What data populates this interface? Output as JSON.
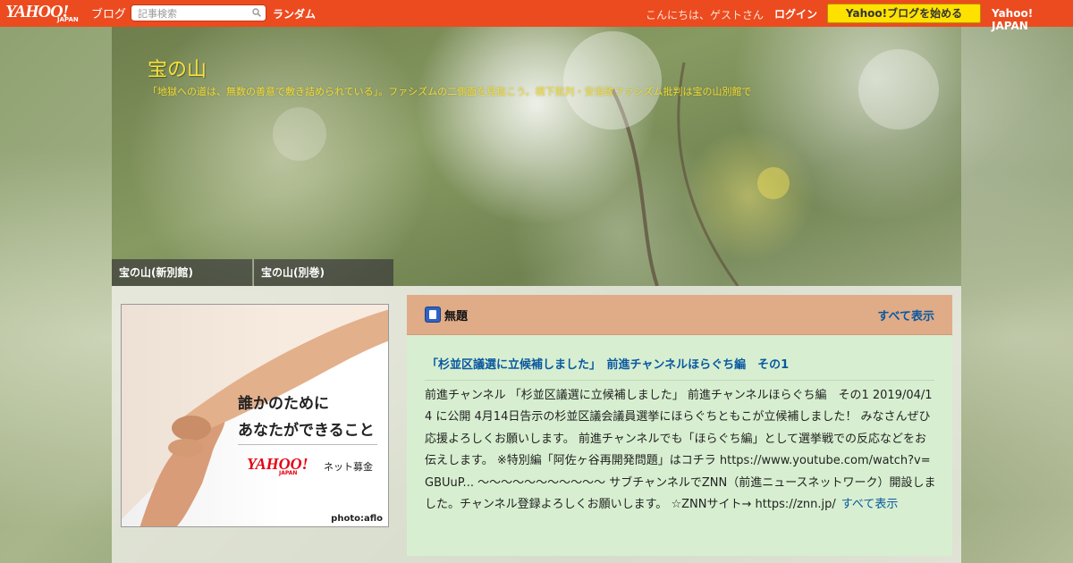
{
  "topbar": {
    "logo_text": "YAHOO!",
    "logo_sub": "JAPAN",
    "blog_label": "ブログ",
    "search_placeholder": "記事検索",
    "random_label": "ランダム",
    "greeting": "こんにちは、ゲストさん",
    "login_label": "ログイン",
    "start_button": "Yahoo!ブログを始める",
    "yahoo_japan_link": "Yahoo! JAPAN"
  },
  "header": {
    "title": "宝の山",
    "description": "「地獄への道は、無数の善意で敷き詰められている」。ファシズムの二側面を見抜こう。橋下批判・安倍政ファシズム批判は宝の山別館で"
  },
  "nav": {
    "tabs": [
      {
        "label": "宝の山(新別館)"
      },
      {
        "label": "宝の山(別巻)"
      }
    ]
  },
  "ad": {
    "line1": "誰かのために",
    "line2": "あなたができること",
    "brand": "YAHOO!",
    "brand_sub": "JAPAN",
    "service": "ネット募金",
    "credit": "photo:aflo"
  },
  "panel": {
    "title": "無題",
    "show_all": "すべて表示",
    "post": {
      "title": "「杉並区議選に立候補しました」　前進チャンネルほらぐち編　その1",
      "body": "前進チャンネル 「杉並区議選に立候補しました」 前進チャンネルほらぐち編　その1 2019/04/14 に公開 4月14日告示の杉並区議会議員選挙にほらぐちともこが立候補しました！ みなさんぜひ応援よろしくお願いします。 前進チャンネルでも「ほらぐち編」として選挙戦での反応などをお伝えします。 ※特別編「阿佐ヶ谷再開発問題」はコチラ https://www.youtube.com/watch?v=GBUuP... ～～～～～～～～～～～ サブチャンネルでZNN（前進ニュースネットワーク）開設しました。チャンネル登録よろしくお願いします。 ☆ZNNサイト→ https://znn.jp/",
      "more_label": "すべて表示"
    }
  },
  "colors": {
    "topbar": "#ec4b1f",
    "start_button": "#ffe100",
    "title_yellow": "#f7e13a",
    "panel_head": "#e0ab87",
    "panel_body": "#d7efd0",
    "link_blue": "#0a58a0"
  },
  "icons": [
    "search-icon",
    "book-icon"
  ]
}
